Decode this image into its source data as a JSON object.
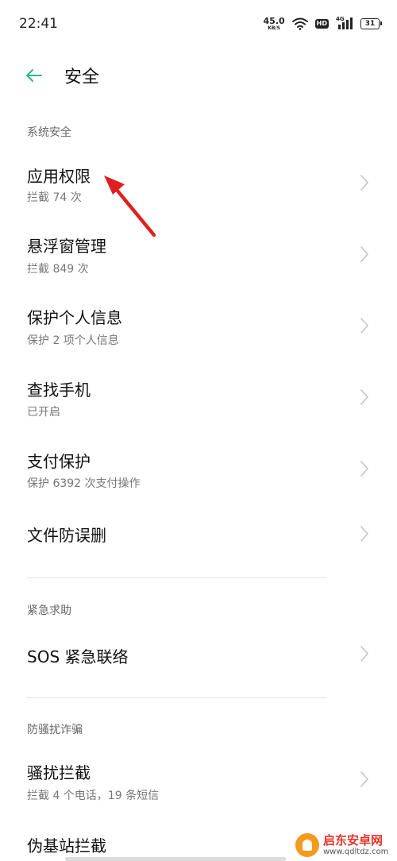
{
  "status_bar": {
    "time": "22:41",
    "net_speed_value": "45.0",
    "net_speed_unit": "KB/S",
    "hd_label": "HD",
    "signal_label": "4G",
    "battery_level": "31"
  },
  "header": {
    "back_icon": "arrow-left-icon",
    "title": "安全",
    "accent_color": "#2eb98a"
  },
  "sections": [
    {
      "header": "系统安全",
      "items": [
        {
          "title": "应用权限",
          "subtitle": "拦截 74 次"
        },
        {
          "title": "悬浮窗管理",
          "subtitle": "拦截 849 次"
        },
        {
          "title": "保护个人信息",
          "subtitle": "保护 2 项个人信息"
        },
        {
          "title": "查找手机",
          "subtitle": "已开启"
        },
        {
          "title": "支付保护",
          "subtitle": "保护 6392 次支付操作"
        },
        {
          "title": "文件防误删"
        }
      ]
    },
    {
      "header": "紧急求助",
      "items": [
        {
          "title": "SOS 紧急联络"
        }
      ]
    },
    {
      "header": "防骚扰诈骗",
      "items": [
        {
          "title": "骚扰拦截",
          "subtitle": "拦截 4 个电话，19 条短信"
        },
        {
          "title": "伪基站拦截"
        }
      ]
    }
  ],
  "annotation": {
    "type": "red-arrow",
    "color": "#e02020"
  },
  "watermark": {
    "name": "启东安卓网",
    "url": "www.qdltdz.com",
    "color": "#e8342a"
  }
}
